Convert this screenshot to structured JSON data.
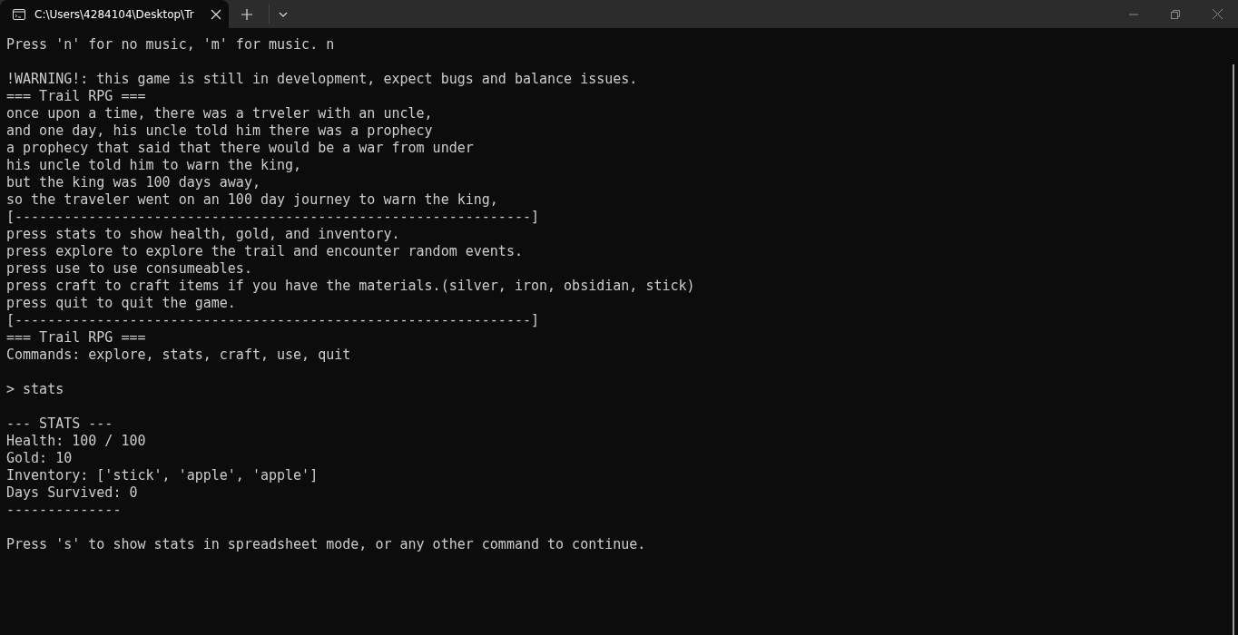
{
  "tab": {
    "title": "C:\\Users\\4284104\\Desktop\\Tr",
    "selected": true
  },
  "blocks": [
    [
      "Press 'n' for no music, 'm' for music. n"
    ],
    [
      "!WARNING!: this game is still in development, expect bugs and balance issues.",
      "=== Trail RPG ===",
      "once upon a time, there was a trveler with an uncle,",
      "and one day, his uncle told him there was a prophecy",
      "a prophecy that said that there would be a war from under",
      "his uncle told him to warn the king,",
      "but the king was 100 days away,",
      "so the traveler went on an 100 day journey to warn the king,",
      "[---------------------------------------------------------------]",
      "press stats to show health, gold, and inventory.",
      "press explore to explore the trail and encounter random events.",
      "press use to use consumeables.",
      "press craft to craft items if you have the materials.(silver, iron, obsidian, stick)",
      "press quit to quit the game.",
      "[---------------------------------------------------------------]",
      "=== Trail RPG ===",
      "Commands: explore, stats, craft, use, quit"
    ],
    [
      "> stats"
    ],
    [
      "--- STATS ---",
      "Health: 100 / 100",
      "Gold: 10",
      "Inventory: ['stick', 'apple', 'apple']",
      "Days Survived: 0",
      "--------------"
    ],
    [
      "Press 's' to show stats in spreadsheet mode, or any other command to continue."
    ]
  ]
}
